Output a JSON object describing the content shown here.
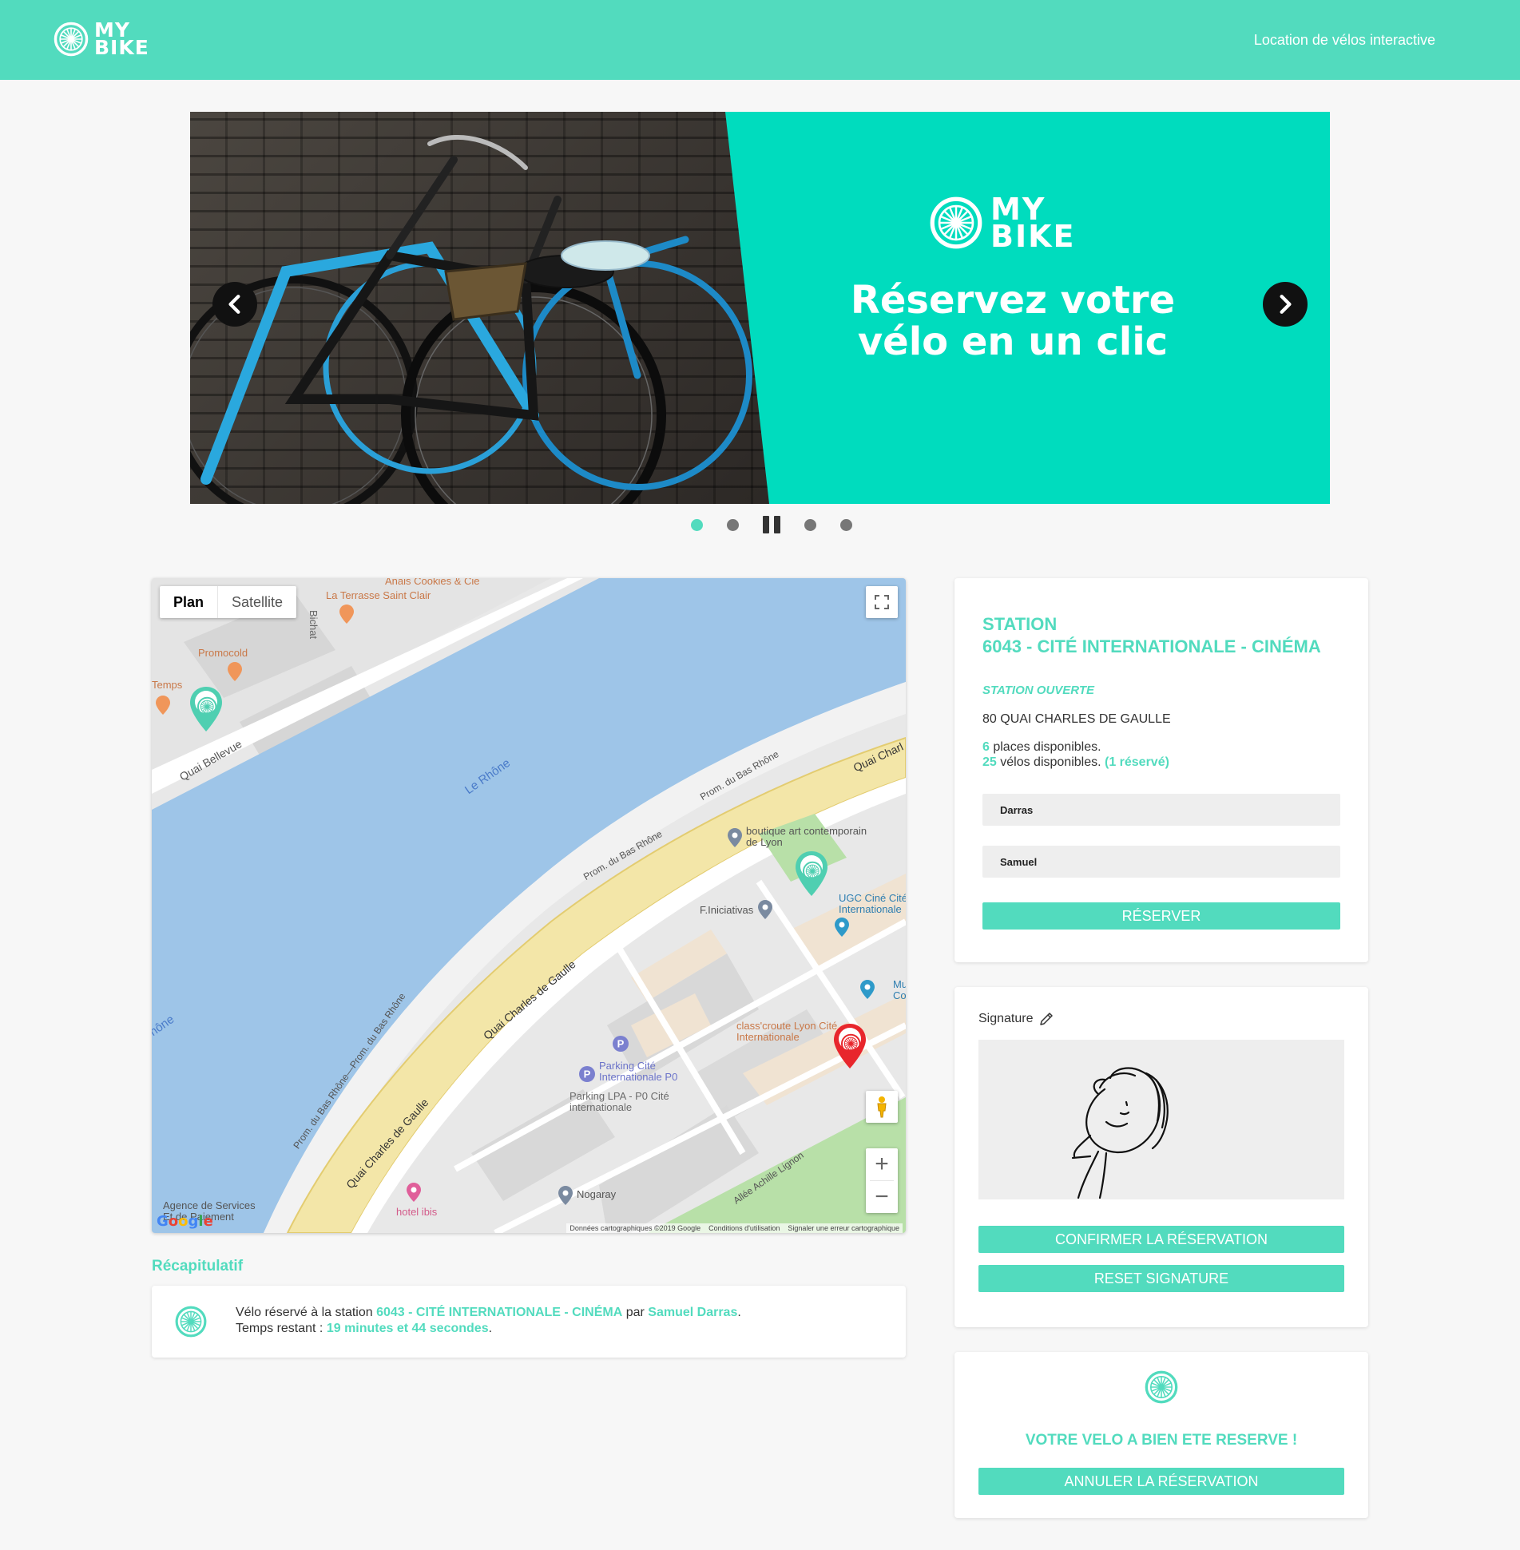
{
  "header": {
    "logo_top": "MY",
    "logo_bottom": "BIKE",
    "tagline": "Location de vélos interactive"
  },
  "slider": {
    "logo_top": "MY",
    "logo_bottom": "BIKE",
    "headline_line1": "Réservez votre",
    "headline_line2": "vélo en un clic",
    "slide_count": 4,
    "active_slide": 1
  },
  "map": {
    "type_plan": "Plan",
    "type_satellite": "Satellite",
    "attribution": [
      "Données cartographiques ©2019 Google",
      "Conditions d'utilisation",
      "Signaler une erreur cartographique"
    ],
    "google_logo": "Google",
    "labels": {
      "cookies": "Anais Cookies & Cie",
      "terrasse": "La Terrasse Saint Clair",
      "promocold": "Promocold",
      "temps": "Temps",
      "quai_bellevue": "Quai Bellevue",
      "le_rhone": "Le Rhône",
      "rhone_left": "hône",
      "prom_1": "Prom. du Bas Rhône",
      "prom_2": "Prom. du Bas Rhône",
      "prom_3": "Prom. du Bas Rhône—Prom. du Bas Rhône",
      "quai_charles_1": "Quai Charles de Gaulle",
      "quai_charles_2": "Quai Charles de Gaulle",
      "quai_charl": "Quai Charl",
      "boutique": "boutique art contemporain de Lyon",
      "iniciativas": "F.Iniciativas",
      "ugc": "UGC Ciné Cité Internationale",
      "mu": "Mu Co",
      "classcroute": "class'croute Lyon Cité Internationale",
      "parking_p0": "Parking Cité Internationale P0",
      "parking_lpa": "Parking LPA - P0 Cité internationale",
      "nogaray": "Nogaray",
      "hotel": "hotel ibis",
      "agence": "Agence de Services Et de Paiement",
      "allee": "Allée Achille Lignon",
      "bichat": "Bichat"
    }
  },
  "recap": {
    "title": "Récapitulatif",
    "line1_prefix": "Vélo réservé à la station ",
    "station": "6043 - CITÉ INTERNATIONALE - CINÉMA",
    "line1_by": " par ",
    "user": "Samuel Darras",
    "line1_end": ".",
    "line2_prefix": "Temps restant : ",
    "time_left": "19 minutes et 44 secondes",
    "line2_end": "."
  },
  "station": {
    "label": "STATION",
    "name": "6043 - CITÉ INTERNATIONALE - CINÉMA",
    "status": "STATION OUVERTE",
    "address": "80 QUAI CHARLES DE GAULLE",
    "places_count": "6",
    "places_text": " places disponibles.",
    "bikes_count": "25",
    "bikes_text": " vélos disponibles. ",
    "reserved_text": "(1 réservé)",
    "last_name": "Darras",
    "first_name": "Samuel",
    "reserve_button": "RÉSERVER"
  },
  "signature": {
    "label": "Signature",
    "confirm_button": "CONFIRMER LA RÉSERVATION",
    "reset_button": "RESET SIGNATURE"
  },
  "confirmation": {
    "message": "VOTRE VELO A BIEN ETE RESERVE !",
    "cancel_button": "ANNULER LA RÉSERVATION"
  },
  "colors": {
    "accent": "#52dbbe",
    "banner": "#00dcbe",
    "marker_selected": "#e8262c"
  }
}
